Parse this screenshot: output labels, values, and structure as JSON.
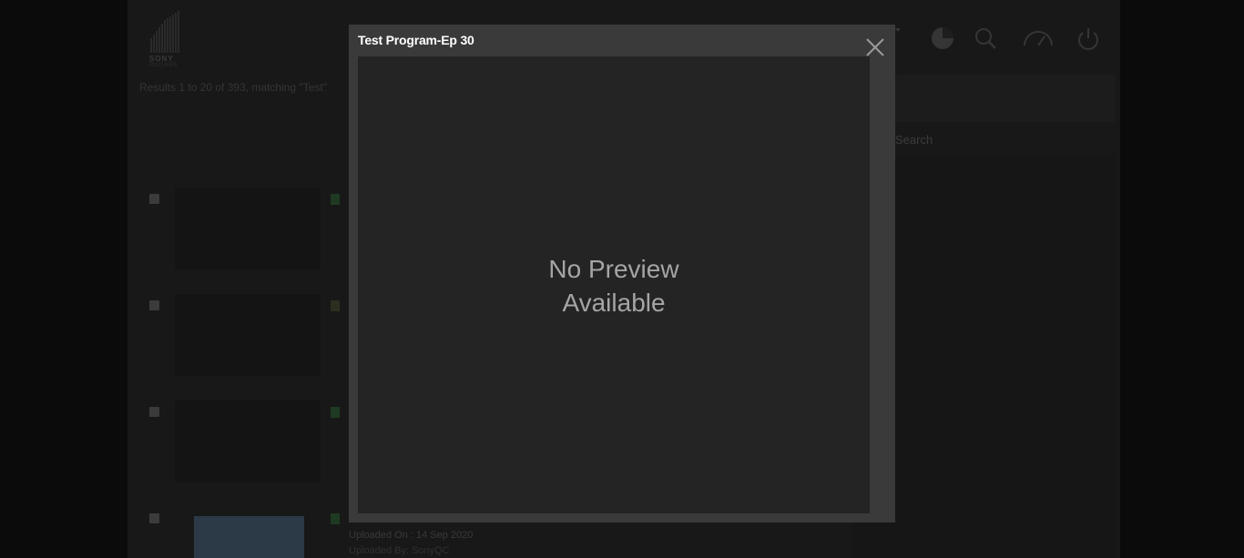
{
  "background": {
    "logo_text": "SONY",
    "logo_subtext": "PICTURES",
    "results_text": "Results 1 to 20 of 393, matching \"Test\"",
    "search_link": "Search",
    "row4_meta1": "Uploaded On : 14 Sep 2020",
    "row4_meta2": "Uploaded By: SonyQC",
    "icons": [
      "pie-chart-icon",
      "search-icon",
      "dashboard-icon",
      "power-icon"
    ]
  },
  "modal": {
    "title": "Test Program-Ep 30",
    "preview_text_line1": "No Preview",
    "preview_text_line2": "Available",
    "close_icon": "close-icon"
  },
  "colors": {
    "overlay": "#0b0b0b",
    "modal_bg": "#3a3a3a",
    "preview_bg": "#242424",
    "title": "#ffffff",
    "preview_text": "#a5a5a5"
  }
}
